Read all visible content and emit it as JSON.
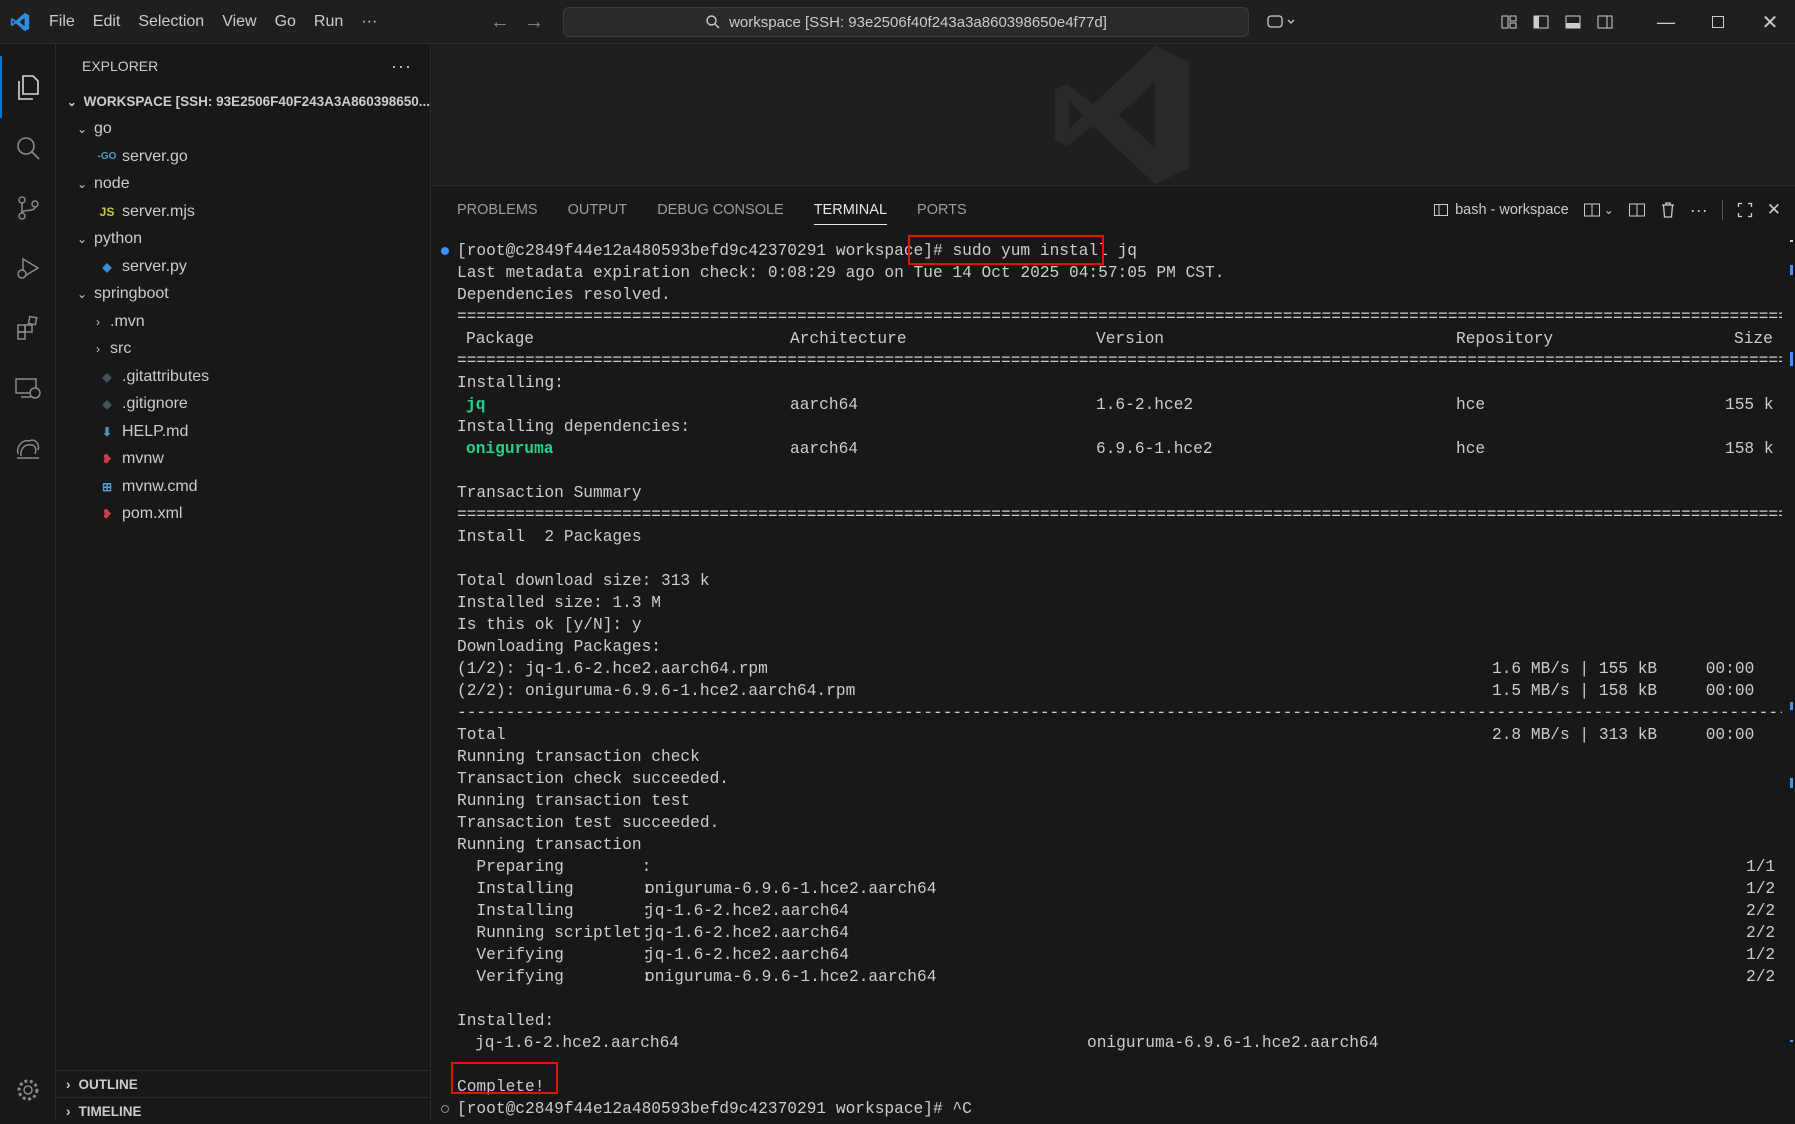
{
  "menu": [
    "File",
    "Edit",
    "Selection",
    "View",
    "Go",
    "Run",
    "···"
  ],
  "search": {
    "text": "workspace [SSH: 93e2506f40f243a3a860398650e4f77d]"
  },
  "explorer": {
    "title": "EXPLORER",
    "workspace_label": "WORKSPACE [SSH: 93E2506F40F243A3A860398650...",
    "items": [
      {
        "label": "go",
        "type": "folder",
        "depth": 1,
        "open": true
      },
      {
        "label": "server.go",
        "type": "go",
        "depth": 2
      },
      {
        "label": "node",
        "type": "folder",
        "depth": 1,
        "open": true
      },
      {
        "label": "server.mjs",
        "type": "js",
        "depth": 2
      },
      {
        "label": "python",
        "type": "folder",
        "depth": 1,
        "open": true
      },
      {
        "label": "server.py",
        "type": "py",
        "depth": 2
      },
      {
        "label": "springboot",
        "type": "folder",
        "depth": 1,
        "open": true
      },
      {
        "label": ".mvn",
        "type": "folder",
        "depth": 2,
        "open": false
      },
      {
        "label": "src",
        "type": "folder",
        "depth": 2,
        "open": false
      },
      {
        "label": ".gitattributes",
        "type": "git",
        "depth": 2
      },
      {
        "label": ".gitignore",
        "type": "git",
        "depth": 2
      },
      {
        "label": "HELP.md",
        "type": "md",
        "depth": 2
      },
      {
        "label": "mvnw",
        "type": "mvn",
        "depth": 2
      },
      {
        "label": "mvnw.cmd",
        "type": "cmd",
        "depth": 2
      },
      {
        "label": "pom.xml",
        "type": "mvn",
        "depth": 2
      }
    ],
    "outline": "OUTLINE",
    "timeline": "TIMELINE"
  },
  "panel": {
    "tabs": [
      "PROBLEMS",
      "OUTPUT",
      "DEBUG CONSOLE",
      "TERMINAL",
      "PORTS"
    ],
    "active_tab": "TERMINAL",
    "terminal_name": "bash - workspace"
  },
  "terminal": {
    "prompt": "[root@c2849f44e12a480593befd9c42370291 workspace]#",
    "command": "sudo yum install jq",
    "metadata": "Last metadata expiration check: 0:08:29 ago on Tue 14 Oct 2025 04:57:05 PM CST.",
    "deps_resolved": "Dependencies resolved.",
    "headers": [
      "Package",
      "Architecture",
      "Version",
      "Repository",
      "Size"
    ],
    "installing_label": "Installing:",
    "installing_deps_label": "Installing dependencies:",
    "packages": [
      {
        "name": "jq",
        "arch": "aarch64",
        "version": "1.6-2.hce2",
        "repo": "hce",
        "size": "155 k"
      },
      {
        "name": "oniguruma",
        "arch": "aarch64",
        "version": "6.9.6-1.hce2",
        "repo": "hce",
        "size": "158 k"
      }
    ],
    "summary": "Transaction Summary",
    "install_count": "Install  2 Packages",
    "total_download": "Total download size: 313 k",
    "installed_size": "Installed size: 1.3 M",
    "confirm": "Is this ok [y/N]: y",
    "downloading": "Downloading Packages:",
    "downloads": [
      {
        "file": "(1/2): jq-1.6-2.hce2.aarch64.rpm",
        "speed": "1.6 MB/s | 155 kB     00:00"
      },
      {
        "file": "(2/2): oniguruma-6.9.6-1.hce2.aarch64.rpm",
        "speed": "1.5 MB/s | 158 kB     00:00"
      }
    ],
    "total": {
      "label": "Total",
      "speed": "2.8 MB/s | 313 kB     00:00"
    },
    "steps": [
      "Running transaction check",
      "Transaction check succeeded.",
      "Running transaction test",
      "Transaction test succeeded.",
      "Running transaction"
    ],
    "tx": [
      {
        "action": "  Preparing        :",
        "pkg": "",
        "n": "1/1"
      },
      {
        "action": "  Installing       :",
        "pkg": "oniguruma-6.9.6-1.hce2.aarch64",
        "n": "1/2"
      },
      {
        "action": "  Installing       :",
        "pkg": "jq-1.6-2.hce2.aarch64",
        "n": "2/2"
      },
      {
        "action": "  Running scriptlet:",
        "pkg": "jq-1.6-2.hce2.aarch64",
        "n": "2/2"
      },
      {
        "action": "  Verifying        :",
        "pkg": "jq-1.6-2.hce2.aarch64",
        "n": "1/2"
      },
      {
        "action": "  Verifying        :",
        "pkg": "oniguruma-6.9.6-1.hce2.aarch64",
        "n": "2/2"
      }
    ],
    "installed_label": "Installed:",
    "installed": [
      "jq-1.6-2.hce2.aarch64",
      "oniguruma-6.9.6-1.hce2.aarch64"
    ],
    "complete": "Complete!",
    "last_line": "[root@c2849f44e12a480593befd9c42370291 workspace]# ^C"
  },
  "colors": {
    "accent": "#3794ff",
    "highlight": "#e51400",
    "green": "#23d18b"
  }
}
